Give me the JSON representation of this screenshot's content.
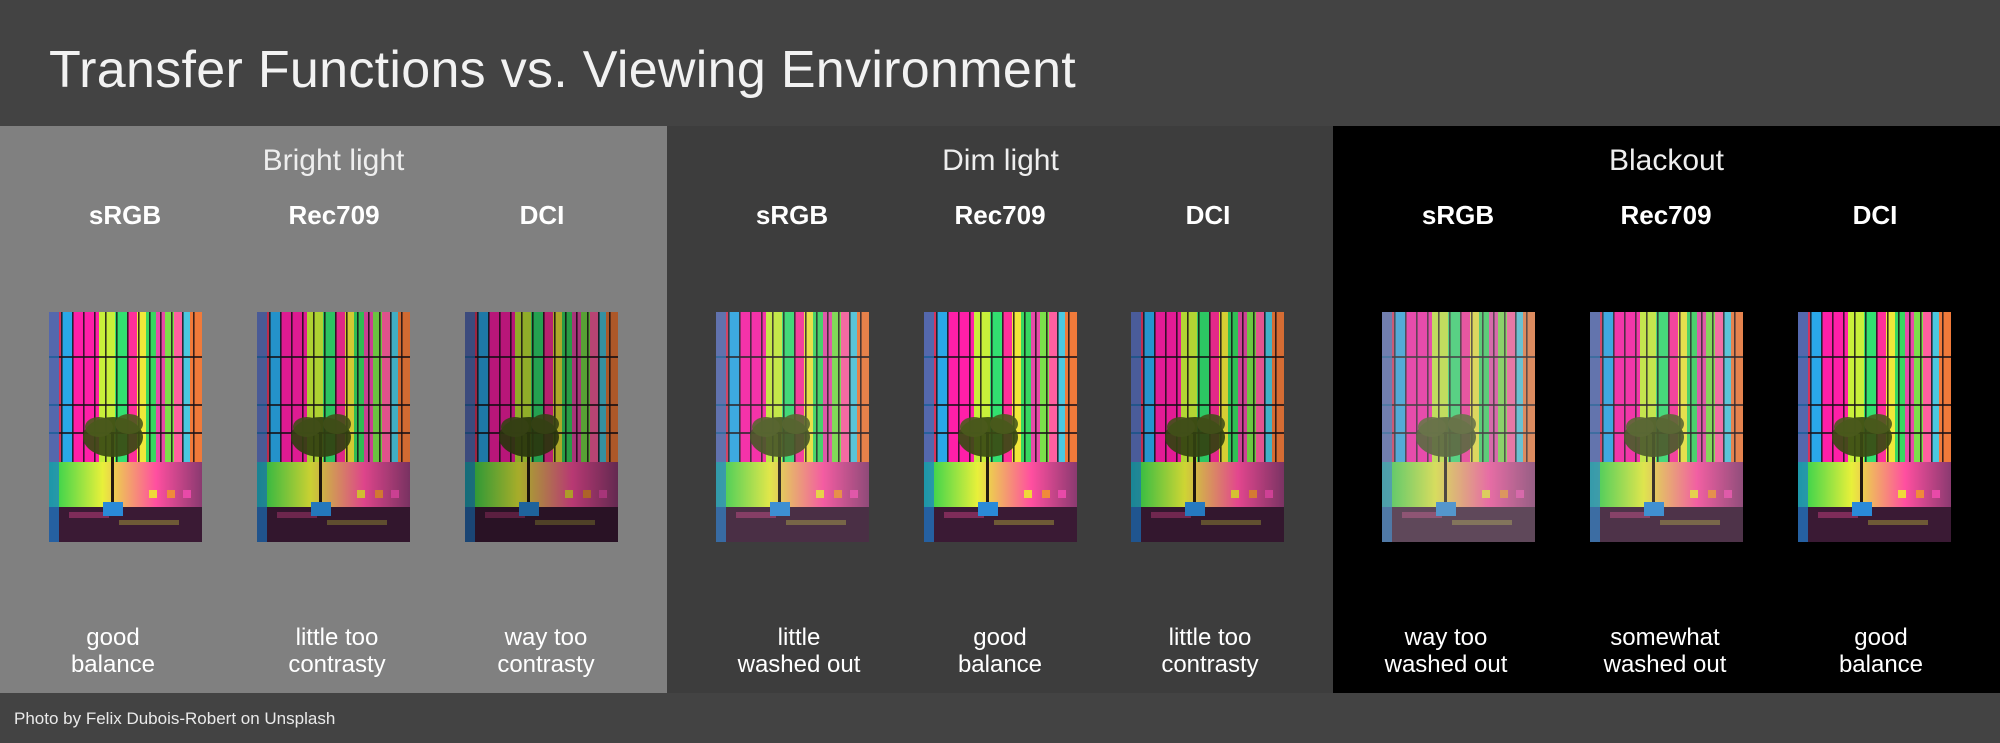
{
  "title": "Transfer Functions vs. Viewing Environment",
  "credit": "Photo by Felix Dubois-Robert on Unsplash",
  "photo_icon": "stained-glass-window-photo",
  "panels": [
    {
      "name": "Bright light",
      "background": "#808080",
      "columns": [
        {
          "label": "sRGB",
          "verdict_line1": "good",
          "verdict_line2": "balance"
        },
        {
          "label": "Rec709",
          "verdict_line1": "little too",
          "verdict_line2": "contrasty"
        },
        {
          "label": "DCI",
          "verdict_line1": "way too",
          "verdict_line2": "contrasty"
        }
      ]
    },
    {
      "name": "Dim light",
      "background": "#3d3d3d",
      "columns": [
        {
          "label": "sRGB",
          "verdict_line1": "little",
          "verdict_line2": "washed out"
        },
        {
          "label": "Rec709",
          "verdict_line1": "good",
          "verdict_line2": "balance"
        },
        {
          "label": "DCI",
          "verdict_line1": "little too",
          "verdict_line2": "contrasty"
        }
      ]
    },
    {
      "name": "Blackout",
      "background": "#000000",
      "columns": [
        {
          "label": "sRGB",
          "verdict_line1": "way too",
          "verdict_line2": "washed out"
        },
        {
          "label": "Rec709",
          "verdict_line1": "somewhat",
          "verdict_line2": "washed out"
        },
        {
          "label": "DCI",
          "verdict_line1": "good",
          "verdict_line2": "balance"
        }
      ]
    }
  ]
}
